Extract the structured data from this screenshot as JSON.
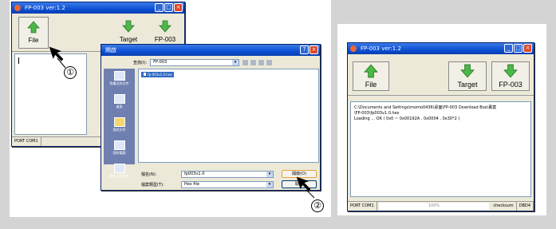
{
  "window_left": {
    "title": "FP-003  ver:1.2",
    "toolbar": [
      {
        "label": "File",
        "icon": "up-arrow-icon",
        "color": "#3aa83a"
      },
      {
        "label": "Target",
        "icon": "down-arrow-icon",
        "color": "#3aa83a"
      },
      {
        "label": "FP-003",
        "icon": "down-arrow-icon",
        "color": "#3aa83a"
      }
    ],
    "status": {
      "port": "PORT",
      "com": "COM1"
    }
  },
  "open_dialog": {
    "title": "開啟",
    "look_in_label": "查詢(I):",
    "look_in_value": "FP-003",
    "places": [
      "我最近的文件",
      "桌面",
      "我的文件",
      "我的電腦",
      "網路上的芳鄰"
    ],
    "selected_file": "fp-003v1.0.hex",
    "filename_label": "檔名(N):",
    "filename_value": "fp003v1.0",
    "filetype_label": "檔案類型(T):",
    "filetype_value": "Hex file",
    "open_button": "開啟(O)",
    "cancel_button": "取消"
  },
  "window_right": {
    "title": "FP-003  ver:1.2",
    "toolbar": [
      {
        "label": "File",
        "icon": "up-arrow-icon"
      },
      {
        "label": "Target",
        "icon": "down-arrow-icon"
      },
      {
        "label": "FP-003",
        "icon": "down-arrow-icon"
      }
    ],
    "log_lines": [
      "C:\\Documents and Settings\\momo0436\\桌面\\FP-003 Download Box\\專案",
      "\\FP-003\\fp003v1.0.hex",
      "Loading ... OK ( 0x0 ~ 0x00192A , 0x0004 , 0x30*2 )"
    ],
    "status": {
      "port": "PORT",
      "com": "COM1",
      "progress": "100%",
      "checksum_label": "checksum",
      "checksum_value": "DBD4"
    }
  },
  "callouts": [
    "①",
    "②"
  ]
}
